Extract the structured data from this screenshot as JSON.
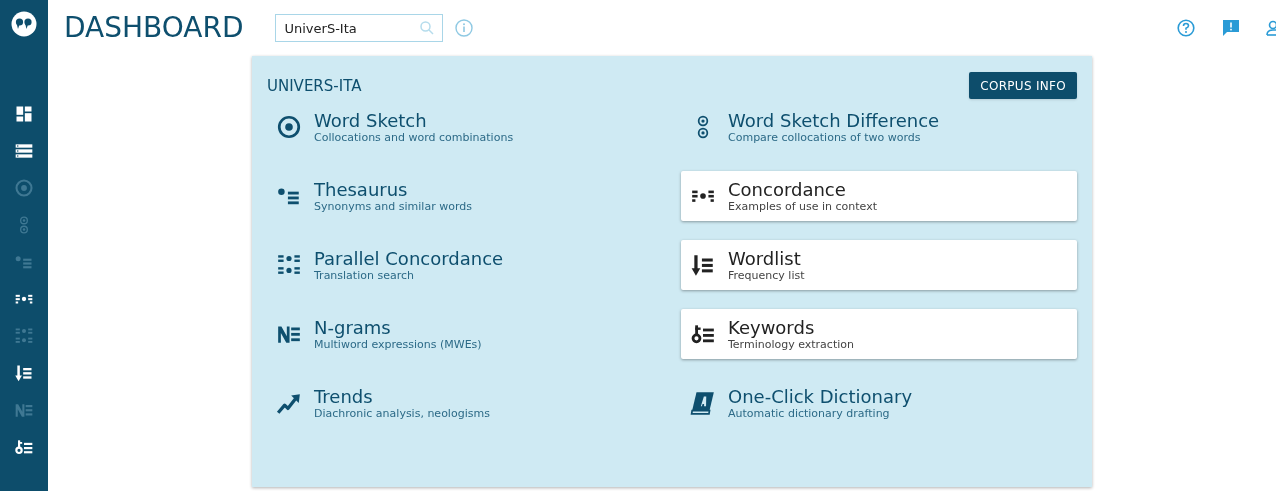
{
  "header": {
    "title": "DASHBOARD",
    "corpus_search": {
      "value": "UniverS-Ita"
    }
  },
  "sidebar": {
    "items": [
      {
        "kind": "dashboard",
        "enabled": true
      },
      {
        "kind": "corpora",
        "enabled": true
      },
      {
        "kind": "wordsketch",
        "enabled": false
      },
      {
        "kind": "wsdiff",
        "enabled": false
      },
      {
        "kind": "thesaurus",
        "enabled": false
      },
      {
        "kind": "concordance",
        "enabled": true
      },
      {
        "kind": "parconc",
        "enabled": false
      },
      {
        "kind": "wordlist",
        "enabled": true
      },
      {
        "kind": "ngrams",
        "enabled": false
      },
      {
        "kind": "keywords",
        "enabled": true
      }
    ]
  },
  "panel": {
    "corpus_name": "UNIVERS-ITA",
    "corpus_info_button": "CORPUS INFO",
    "tools": [
      {
        "kind": "wordsketch",
        "name": "Word Sketch",
        "description": "Collocations and word combinations",
        "enabled": false
      },
      {
        "kind": "wsdiff",
        "name": "Word Sketch Difference",
        "description": "Compare collocations of two words",
        "enabled": false
      },
      {
        "kind": "thesaurus",
        "name": "Thesaurus",
        "description": "Synonyms and similar words",
        "enabled": false
      },
      {
        "kind": "concordance",
        "name": "Concordance",
        "description": "Examples of use in context",
        "enabled": true
      },
      {
        "kind": "parconc",
        "name": "Parallel Concordance",
        "description": "Translation search",
        "enabled": false
      },
      {
        "kind": "wordlist",
        "name": "Wordlist",
        "description": "Frequency list",
        "enabled": true
      },
      {
        "kind": "ngrams",
        "name": "N-grams",
        "description": "Multiword expressions (MWEs)",
        "enabled": false
      },
      {
        "kind": "keywords",
        "name": "Keywords",
        "description": "Terminology extraction",
        "enabled": true
      },
      {
        "kind": "trends",
        "name": "Trends",
        "description": "Diachronic analysis, neologisms",
        "enabled": false
      },
      {
        "kind": "ocd",
        "name": "One-Click Dictionary",
        "description": "Automatic dictionary drafting",
        "enabled": false
      }
    ]
  }
}
